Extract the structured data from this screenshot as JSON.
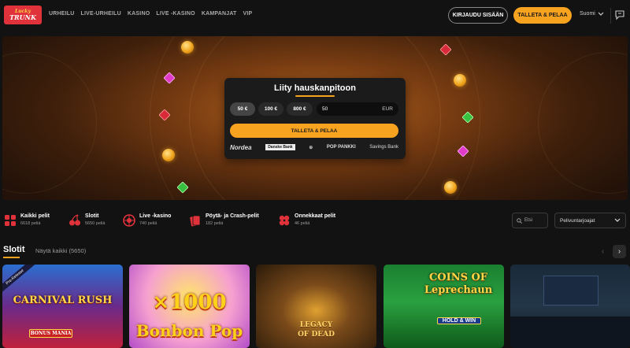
{
  "brand": {
    "line1": "Lucky",
    "line2": "TRUNK"
  },
  "nav": [
    "URHEILU",
    "LIVE-URHEILU",
    "KASINO",
    "LIVE -KASINO",
    "KAMPANJAT",
    "VIP"
  ],
  "header": {
    "login_label": "KIRJAUDU SISÄÄN",
    "deposit_label": "TALLETA & PELAA",
    "language": "Suomi"
  },
  "hero": {
    "title": "Liity hauskanpitoon",
    "amounts": [
      "50 €",
      "100 €",
      "800 €"
    ],
    "selected_amount": "50 €",
    "amount_value": "50",
    "currency": "EUR",
    "play_label": "TALLETA & PELAA",
    "banks": [
      "Nordea",
      "Danske Bank",
      "⊕",
      "POP PANKKI",
      "Savings Bank"
    ]
  },
  "categories": [
    {
      "name": "Kaikki pelit",
      "count": "6618 peliä",
      "icon": "all-games-icon"
    },
    {
      "name": "Slotit",
      "count": "5650 peliä",
      "icon": "cherries-icon"
    },
    {
      "name": "Live -kasino",
      "count": "740 peliä",
      "icon": "roulette-icon"
    },
    {
      "name": "Pöytä- ja Crash-pelit",
      "count": "182 peliä",
      "icon": "cards-icon"
    },
    {
      "name": "Onnekkaat pelit",
      "count": "46 peliä",
      "icon": "clover-icon"
    }
  ],
  "search": {
    "placeholder": "Etsi"
  },
  "provider_filter": {
    "label": "Pelivuntarjoajat"
  },
  "section": {
    "title": "Slotit",
    "see_all": "Näytä kaikki (5650)"
  },
  "games": [
    {
      "title": "CARNIVAL RUSH",
      "subtitle": "BONUS MANIA",
      "badge": "Pre-Release"
    },
    {
      "title": "×1000",
      "subtitle": "Bonbon Pop"
    },
    {
      "title": "LEGACY",
      "subtitle": "OF DEAD"
    },
    {
      "title": "COINS OF Leprechaun",
      "subtitle": "HOLD & WIN"
    },
    {
      "title": "",
      "subtitle": ""
    }
  ],
  "colors": {
    "accent": "#f7a320",
    "background": "#121212",
    "card": "#1b1b1b"
  }
}
